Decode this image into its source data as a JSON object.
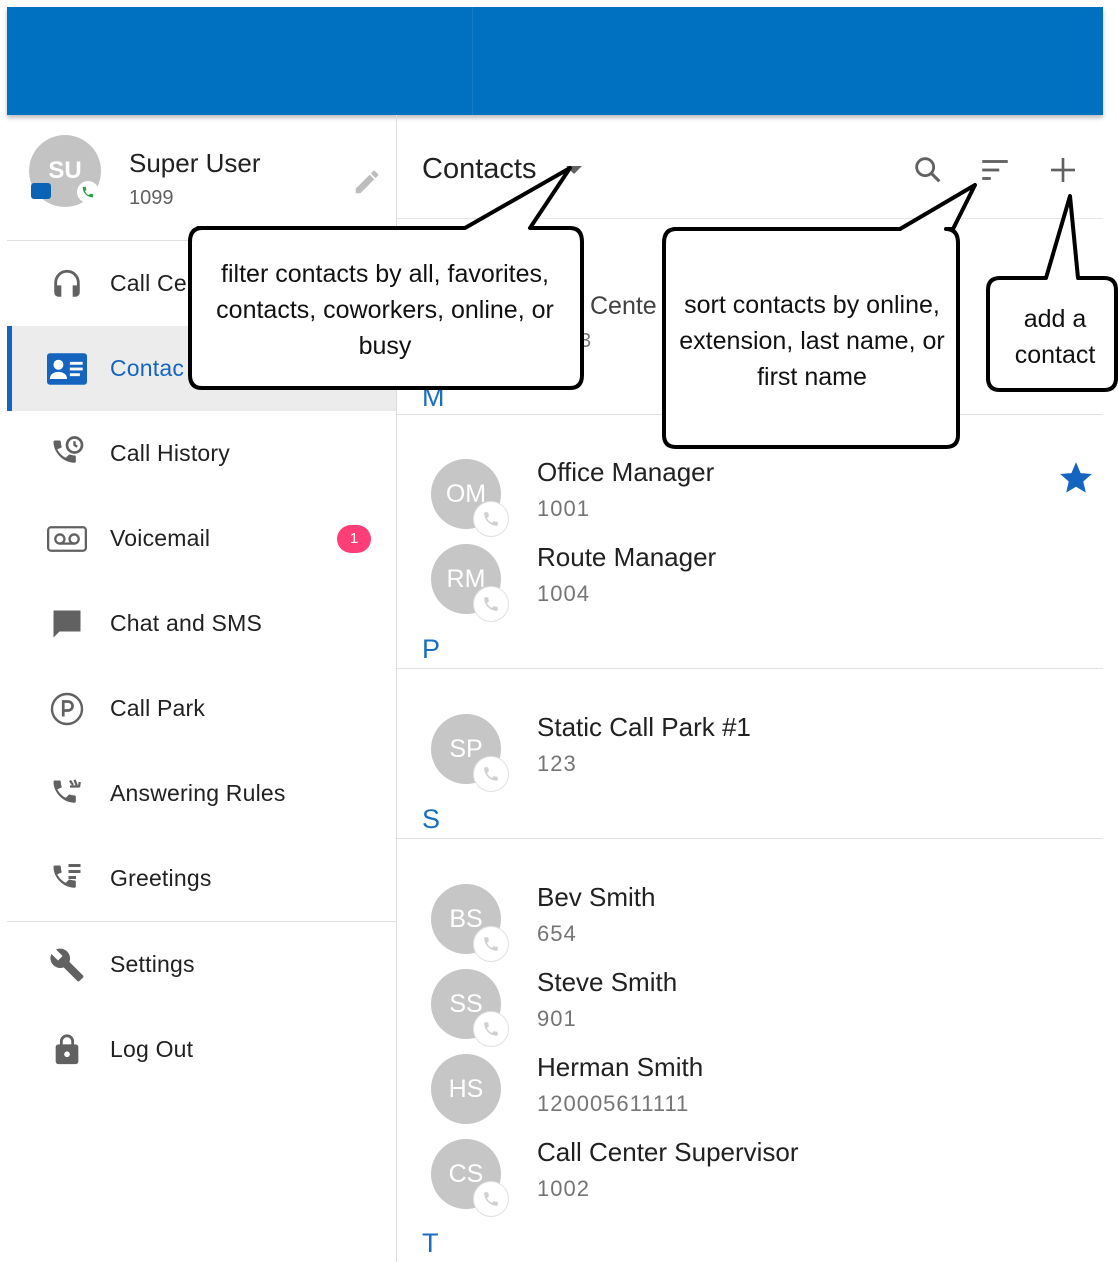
{
  "colors": {
    "top_bar": "#0070c0",
    "accent": "#1565c0",
    "badge": "#ff3d77",
    "avatar_gray": "#c6c6c6"
  },
  "profile": {
    "name": "Super User",
    "extension": "1099",
    "avatar_initials": "SU",
    "edit_icon": "pencil-icon"
  },
  "nav": {
    "items": [
      {
        "label": "Call Ce",
        "icon": "headset-icon",
        "active": false
      },
      {
        "label": "Contac",
        "icon": "contacts-card-icon",
        "active": true
      },
      {
        "label": "Call History",
        "icon": "call-history-icon",
        "active": false
      },
      {
        "label": "Voicemail",
        "icon": "voicemail-icon",
        "active": false,
        "badge": "1"
      },
      {
        "label": "Chat and SMS",
        "icon": "chat-bubble-icon",
        "active": false
      },
      {
        "label": "Call Park",
        "icon": "parking-icon",
        "active": false
      },
      {
        "label": "Answering Rules",
        "icon": "answering-rules-icon",
        "active": false
      },
      {
        "label": "Greetings",
        "icon": "greetings-icon",
        "active": false
      }
    ],
    "secondary": [
      {
        "label": "Settings",
        "icon": "wrench-icon"
      },
      {
        "label": "Log Out",
        "icon": "lock-icon"
      }
    ]
  },
  "header": {
    "title": "Contacts",
    "filter_icon": "dropdown-caret-icon",
    "search_icon": "search-icon",
    "sort_icon": "sort-icon",
    "add_icon": "plus-icon"
  },
  "partial": {
    "behind_callout": "Cente",
    "behind_callout_2": "3",
    "section_m": "M"
  },
  "sections": [
    {
      "letter": "P",
      "contacts": [
        {
          "initials": "OM",
          "name": "Office Manager",
          "ext": "1001",
          "favorite": true
        },
        {
          "initials": "RM",
          "name": "Route Manager",
          "ext": "1004",
          "favorite": false
        }
      ]
    },
    {
      "letter": "S",
      "contacts": [
        {
          "initials": "SP",
          "name": "Static Call Park #1",
          "ext": "123",
          "favorite": false
        }
      ]
    },
    {
      "letter": "T",
      "contacts": [
        {
          "initials": "BS",
          "name": "Bev Smith",
          "ext": "654",
          "favorite": false
        },
        {
          "initials": "SS",
          "name": "Steve Smith",
          "ext": "901",
          "favorite": false
        },
        {
          "initials": "HS",
          "name": "Herman Smith",
          "ext": "120005611111",
          "favorite": false
        },
        {
          "initials": "CS",
          "name": "Call Center Supervisor",
          "ext": "1002",
          "favorite": false
        }
      ]
    }
  ],
  "callouts": {
    "filter": "filter contacts by all, favorites, contacts, coworkers, online, or busy",
    "sort": "sort contacts by online, extension, last name, or first name",
    "add": "add a contact"
  }
}
